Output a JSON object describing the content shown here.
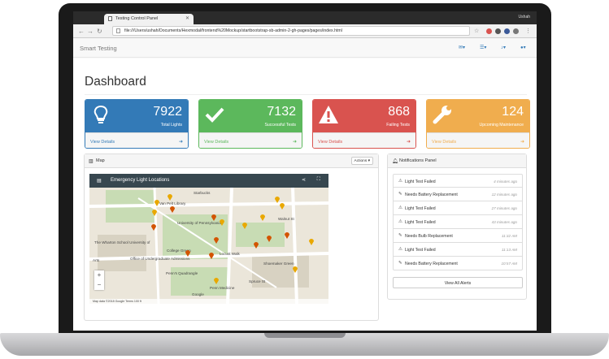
{
  "browser": {
    "tab_title": "Testing Control Panel",
    "user_name": "Ushah",
    "url": "file:///Users/ushah/Documents/Hexmodal/frontend%20Mockup/startbootstrap-sb-admin-2-gh-pages/pages/index.html"
  },
  "app": {
    "brand": "Smart Testing"
  },
  "page": {
    "title": "Dashboard"
  },
  "stats": [
    {
      "value": "7922",
      "label": "Total Lights",
      "link": "View Details",
      "color": "#337ab7",
      "icon": "lightbulb-icon"
    },
    {
      "value": "7132",
      "label": "Successful Tests",
      "link": "View Details",
      "color": "#5cb85c",
      "icon": "check-icon"
    },
    {
      "value": "868",
      "label": "Failing Tests",
      "link": "View Details",
      "color": "#d9534f",
      "icon": "warning-icon"
    },
    {
      "value": "124",
      "label": "Upcoming Maintenance",
      "link": "View Details",
      "color": "#f0ad4e",
      "icon": "wrench-icon"
    }
  ],
  "map_panel": {
    "title": "Map",
    "actions_label": "Actions ▾",
    "map_title": "Emergency Light Locations",
    "credit": "Map data ©2018 Google   Terms   100 ft",
    "labels": [
      "Starbucks",
      "University of Pennsylvania",
      "The Wharton School University of",
      "Office of Undergraduate Admissions",
      "College Green",
      "Penn's Quadrangle",
      "Van Pelt Library",
      "Walnut St",
      "Locust Walk",
      "Spruce St",
      "Shoemaker Green",
      "Google",
      "Penn Medicine",
      "Arts"
    ]
  },
  "notifications": {
    "title": "Notifications Panel",
    "items": [
      {
        "text": "Light Test Failed",
        "time": "4 minutes ago",
        "icon": "warning-icon"
      },
      {
        "text": "Needs Battery Replacement",
        "time": "12 minutes ago",
        "icon": "wrench-icon"
      },
      {
        "text": "Light Test Failed",
        "time": "27 minutes ago",
        "icon": "warning-icon"
      },
      {
        "text": "Light Test Failed",
        "time": "43 minutes ago",
        "icon": "warning-icon"
      },
      {
        "text": "Needs Bulb Replacement",
        "time": "11:32 AM",
        "icon": "wrench-icon"
      },
      {
        "text": "Light Test Failed",
        "time": "11:13 AM",
        "icon": "warning-icon"
      },
      {
        "text": "Needs Battery Replacement",
        "time": "10:57 AM",
        "icon": "wrench-icon"
      }
    ],
    "view_all": "View All Alerts"
  }
}
